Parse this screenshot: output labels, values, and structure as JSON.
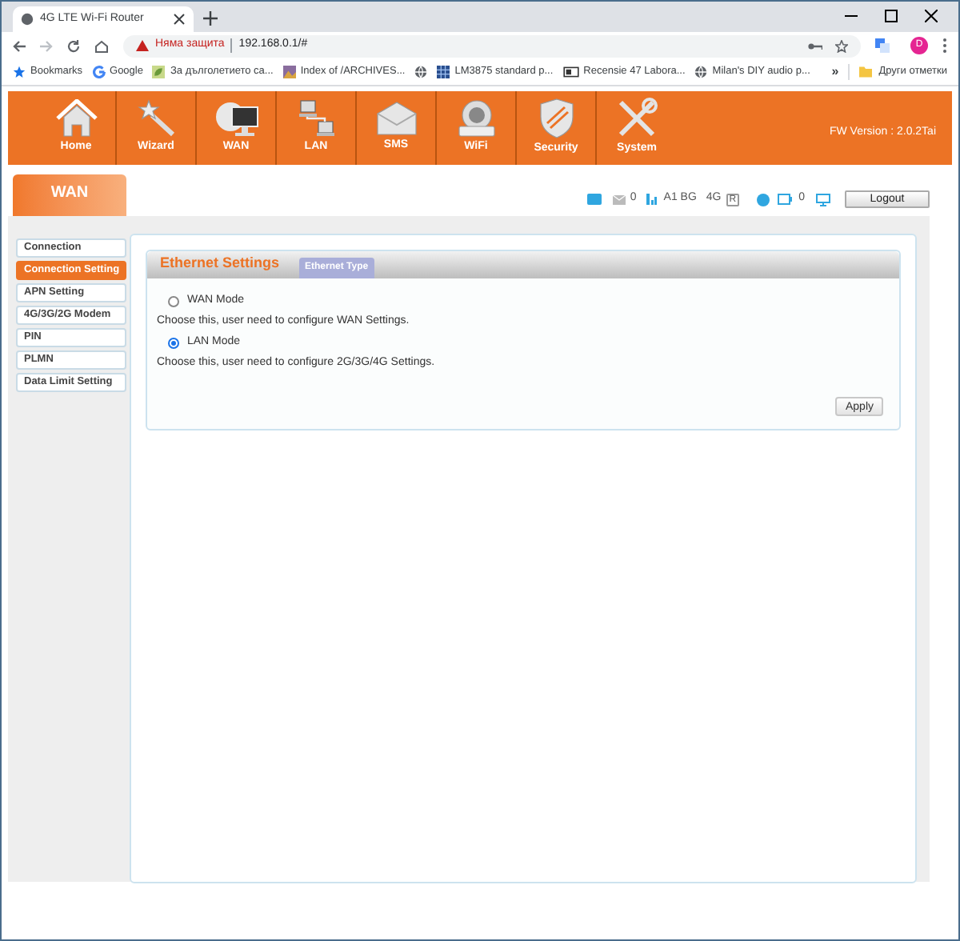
{
  "browser": {
    "tab_title": "4G LTE Wi-Fi Router",
    "security": "Няма защита",
    "url": "192.168.0.1/#",
    "profile": "D",
    "bookmarks": [
      {
        "kind": "link",
        "label": "Bookmarks"
      },
      {
        "kind": "link",
        "label": "Google"
      },
      {
        "kind": "link",
        "label": "За дълголетието са..."
      },
      {
        "kind": "link",
        "label": "Index of /ARCHIVES..."
      },
      {
        "kind": "icon"
      },
      {
        "kind": "link",
        "label": "LM3875 standard p..."
      },
      {
        "kind": "link",
        "label": "Recensie 47 Labora..."
      },
      {
        "kind": "link",
        "label": "Milan's DIY audio p..."
      }
    ],
    "more": "»",
    "other": "Други отметки"
  },
  "nav": [
    {
      "label": "Home"
    },
    {
      "label": "Wizard"
    },
    {
      "label": "WAN"
    },
    {
      "label": "LAN"
    },
    {
      "label": "SMS"
    },
    {
      "label": "WiFi"
    },
    {
      "label": "Security"
    },
    {
      "label": "System"
    }
  ],
  "fw_version": "FW Version : 2.0.2Tai",
  "section_tab": "WAN",
  "status": {
    "messages": "0",
    "operator": "A1 BG",
    "network": "4G",
    "roaming": "R",
    "clients": "0"
  },
  "logout": "Logout",
  "sidebar": [
    {
      "label": "Connection",
      "selected": false
    },
    {
      "label": "Connection Setting",
      "selected": true
    },
    {
      "label": "APN Setting",
      "selected": false
    },
    {
      "label": "4G/3G/2G Modem",
      "selected": false
    },
    {
      "label": "PIN",
      "selected": false
    },
    {
      "label": "PLMN",
      "selected": false
    },
    {
      "label": "Data Limit Setting",
      "selected": false
    }
  ],
  "panel": {
    "title": "Ethernet Settings",
    "subtab": "Ethernet Type",
    "options": [
      {
        "label": "WAN Mode",
        "selected": false,
        "hint": "Choose this, user need to configure WAN Settings."
      },
      {
        "label": "LAN Mode",
        "selected": true,
        "hint": "Choose this, user need to configure 2G/3G/4G Settings."
      }
    ],
    "apply": "Apply"
  }
}
